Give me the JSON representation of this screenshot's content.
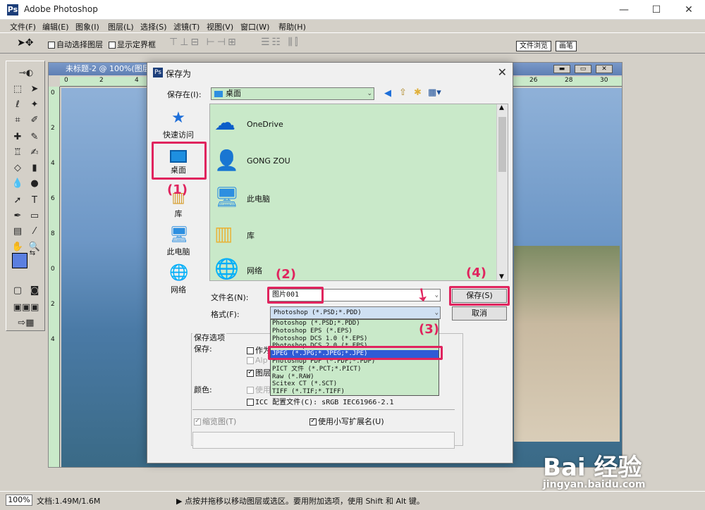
{
  "app": {
    "title": "Adobe Photoshop",
    "controls": {
      "minimize": "—",
      "maximize": "☐",
      "close": "✕"
    }
  },
  "menu": [
    "文件(F)",
    "编辑(E)",
    "图象(I)",
    "图层(L)",
    "选择(S)",
    "滤镜(T)",
    "视图(V)",
    "窗口(W)",
    "帮助(H)"
  ],
  "options_bar": {
    "auto_select_layer": "自动选择图层",
    "show_bounding_box": "显示定界框",
    "palette_tabs": [
      "文件浏览",
      "画笔"
    ]
  },
  "document": {
    "title": "未标题-2 @ 100%(图层",
    "h_ruler_ticks": [
      "0",
      "2",
      "4",
      "26",
      "28",
      "30"
    ],
    "v_ruler_ticks": [
      "0",
      "2",
      "4",
      "6",
      "8",
      "0",
      "2",
      "4"
    ]
  },
  "dialog": {
    "title": "保存为",
    "close": "✕",
    "save_in_label": "保存在(I):",
    "save_in_value": "桌面",
    "places": [
      "快速访问",
      "桌面",
      "库",
      "此电脑",
      "网络"
    ],
    "files": [
      "OneDrive",
      "GONG ZOU",
      "此电脑",
      "库",
      "网络"
    ],
    "filename_label": "文件名(N):",
    "filename_value": "图片001",
    "format_label": "格式(F):",
    "format_value": "Photoshop (*.PSD;*.PDD)",
    "format_options": [
      "Photoshop (*.PSD;*.PDD)",
      "Photoshop EPS (*.EPS)",
      "Photoshop DCS 1.0 (*.EPS)",
      "Photoshop DCS 2.0 (*.EPS)",
      "JPEG (*.JPG;*.JPEG;*.JPE)",
      "Photoshop PDF (*.PDF;*.PDP)",
      "PICT 文件 (*.PCT;*.PICT)",
      "Raw (*.RAW)",
      "Scitex CT (*.SCT)",
      "TIFF (*.TIF;*.TIFF)"
    ],
    "selected_format_index": 4,
    "save_button": "保存(S)",
    "cancel_button": "取消",
    "save_options_header": "保存选项",
    "save_label": "保存:",
    "save_as_copy": "作为",
    "alpha": "Alp",
    "layers": "图层",
    "color_label": "颜色:",
    "use_proof": "使用",
    "icc_profile": "ICC 配置文件(C): sRGB IEC61966-2.1",
    "thumbnail": "缩览图(T)",
    "lowercase_ext": "使用小写扩展名(U)"
  },
  "annotations": [
    "(1)",
    "(2)",
    "(3)",
    "(4)"
  ],
  "status": {
    "zoom": "100%",
    "doc_size": "文档:1.49M/1.6M",
    "hint": "▶ 点按并拖移以移动图层或选区。要用附加选项，使用 Shift 和 Alt 键。"
  },
  "watermark": {
    "brand": "Bai 经验",
    "url": "jingyan.baidu.com"
  },
  "colors": {
    "annotation": "#e0245e",
    "selection": "#2f5bd6",
    "panel_green": "#c9e9c9"
  }
}
